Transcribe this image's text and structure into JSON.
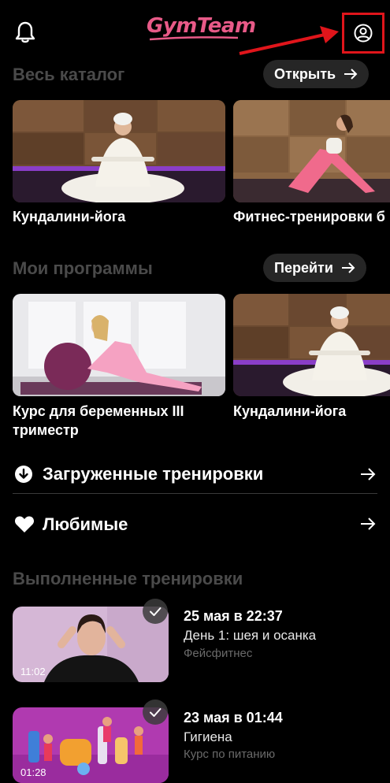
{
  "header": {
    "logo_text": "GymTeam",
    "bell_icon": "bell-icon",
    "profile_icon": "user-circle-icon",
    "highlight_color": "#e0151b",
    "brand_color": "#e85a88"
  },
  "catalog": {
    "title": "Весь каталог",
    "button_label": "Открыть",
    "cards": [
      {
        "title": "Кундалини-йога"
      },
      {
        "title": "Фитнес-тренировки б"
      }
    ]
  },
  "programs": {
    "title": "Мои программы",
    "button_label": "Перейти",
    "cards": [
      {
        "title_line1": "Курс для беременных III",
        "title_line2": "триместр"
      },
      {
        "title_line1": "Кундалини-йога"
      }
    ]
  },
  "downloads": {
    "label": "Загруженные тренировки",
    "icon": "download-icon"
  },
  "favorites": {
    "label": "Любимые",
    "icon": "heart-icon"
  },
  "completed": {
    "title": "Выполненные тренировки",
    "items": [
      {
        "duration": "11:02",
        "date": "25 мая в 22:37",
        "name": "День 1: шея и осанка",
        "program": "Фейсфитнес"
      },
      {
        "duration": "01:28",
        "date": "23 мая в 01:44",
        "name": "Гигиена",
        "program": "Курс по питанию"
      }
    ]
  }
}
